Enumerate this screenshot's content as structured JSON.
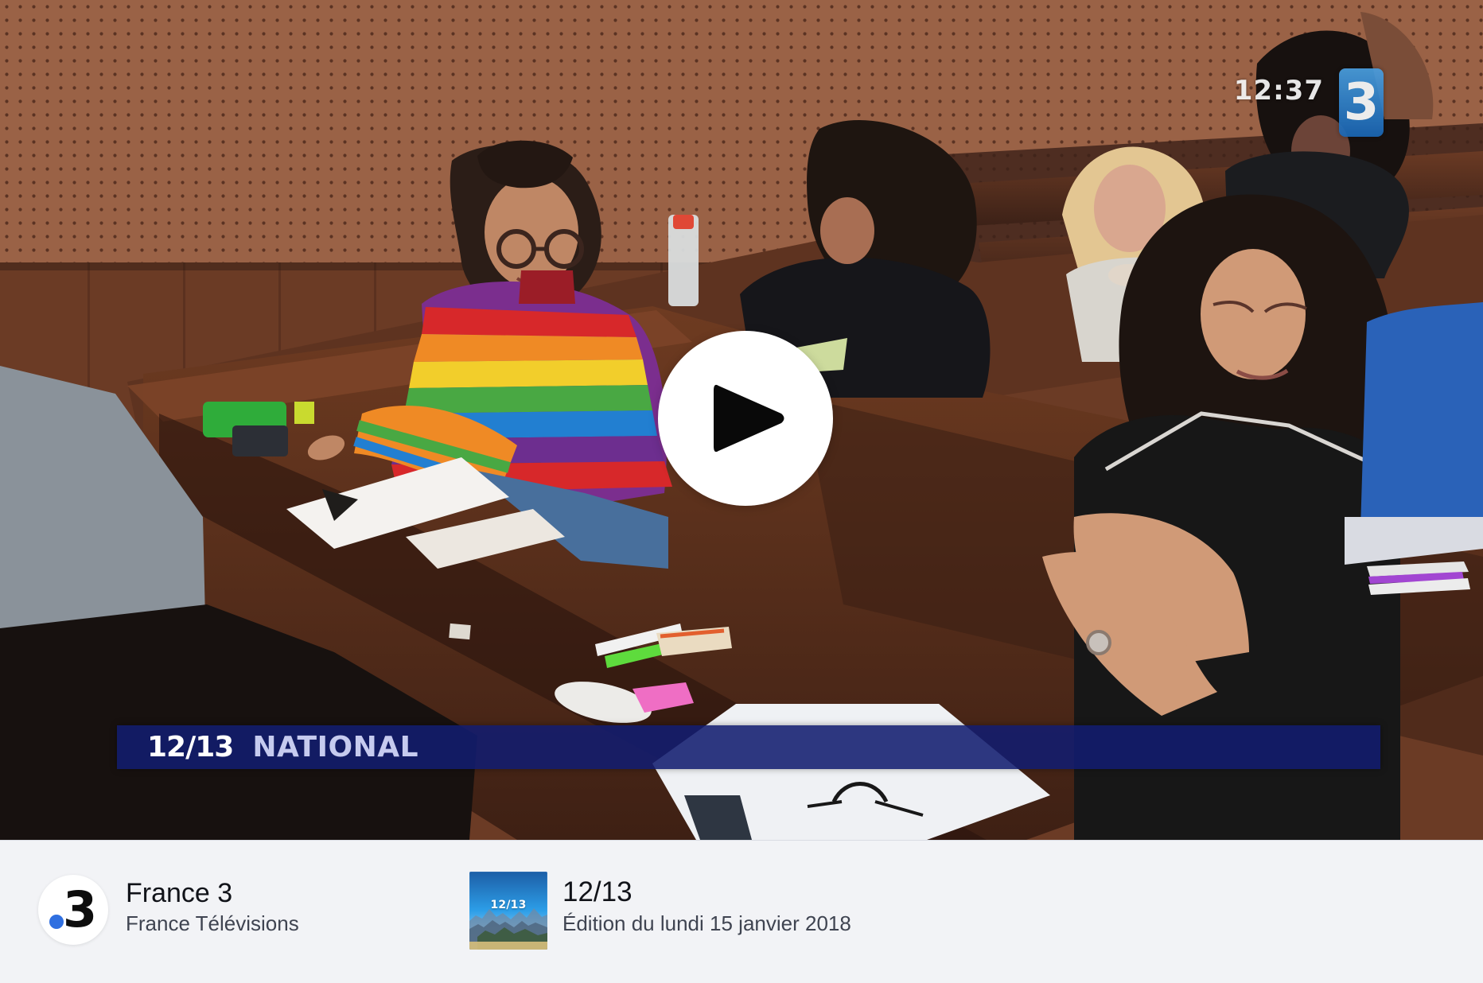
{
  "video": {
    "clock": "12:37",
    "corner_channel_number": "3",
    "lower_third": {
      "show": "12/13",
      "label": "NATIONAL"
    }
  },
  "info_bar": {
    "channel": {
      "name": "France 3",
      "network": "France Télévisions",
      "logo_number": "3"
    },
    "program": {
      "title": "12/13",
      "edition": "Édition du lundi 15 janvier 2018",
      "thumbnail_title": "12/13"
    }
  },
  "icons": {
    "play": "play-icon",
    "channel": "france-3-logo-icon"
  },
  "colors": {
    "lower_third_background": "#121c70",
    "channel_dot": "#2f6fe0",
    "info_bar_background": "#f2f3f6",
    "title_text": "#111319",
    "subtitle_text": "#3f4451"
  }
}
